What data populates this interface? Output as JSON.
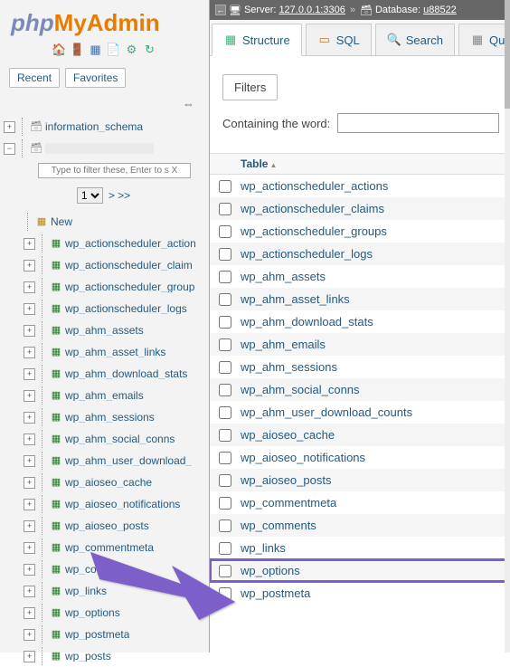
{
  "logo": {
    "p1": "php",
    "p2": "MyAdmin"
  },
  "sidebar": {
    "recent": "Recent",
    "favorites": "Favorites",
    "filter_placeholder": "Type to filter these, Enter to s X",
    "pager": {
      "page": "1",
      "next": "> >>"
    },
    "top_db": "information_schema",
    "new": "New",
    "tables": [
      "wp_actionscheduler_action",
      "wp_actionscheduler_claim",
      "wp_actionscheduler_group",
      "wp_actionscheduler_logs",
      "wp_ahm_assets",
      "wp_ahm_asset_links",
      "wp_ahm_download_stats",
      "wp_ahm_emails",
      "wp_ahm_sessions",
      "wp_ahm_social_conns",
      "wp_ahm_user_download_",
      "wp_aioseo_cache",
      "wp_aioseo_notifications",
      "wp_aioseo_posts",
      "wp_commentmeta",
      "wp_comments",
      "wp_links",
      "wp_options",
      "wp_postmeta",
      "wp_posts"
    ]
  },
  "breadcrumb": {
    "server_label": "Server:",
    "server_value": "127.0.0.1:3306",
    "db_label": "Database:",
    "db_value": "u88522"
  },
  "tabs": [
    {
      "label": "Structure",
      "active": true
    },
    {
      "label": "SQL"
    },
    {
      "label": "Search"
    },
    {
      "label": "Qu"
    }
  ],
  "filters": {
    "legend": "Filters",
    "label": "Containing the word:"
  },
  "table_header": "Table",
  "main_tables": [
    "wp_actionscheduler_actions",
    "wp_actionscheduler_claims",
    "wp_actionscheduler_groups",
    "wp_actionscheduler_logs",
    "wp_ahm_assets",
    "wp_ahm_asset_links",
    "wp_ahm_download_stats",
    "wp_ahm_emails",
    "wp_ahm_sessions",
    "wp_ahm_social_conns",
    "wp_ahm_user_download_counts",
    "wp_aioseo_cache",
    "wp_aioseo_notifications",
    "wp_aioseo_posts",
    "wp_commentmeta",
    "wp_comments",
    "wp_links",
    "wp_options",
    "wp_postmeta"
  ],
  "highlight_table": "wp_options"
}
